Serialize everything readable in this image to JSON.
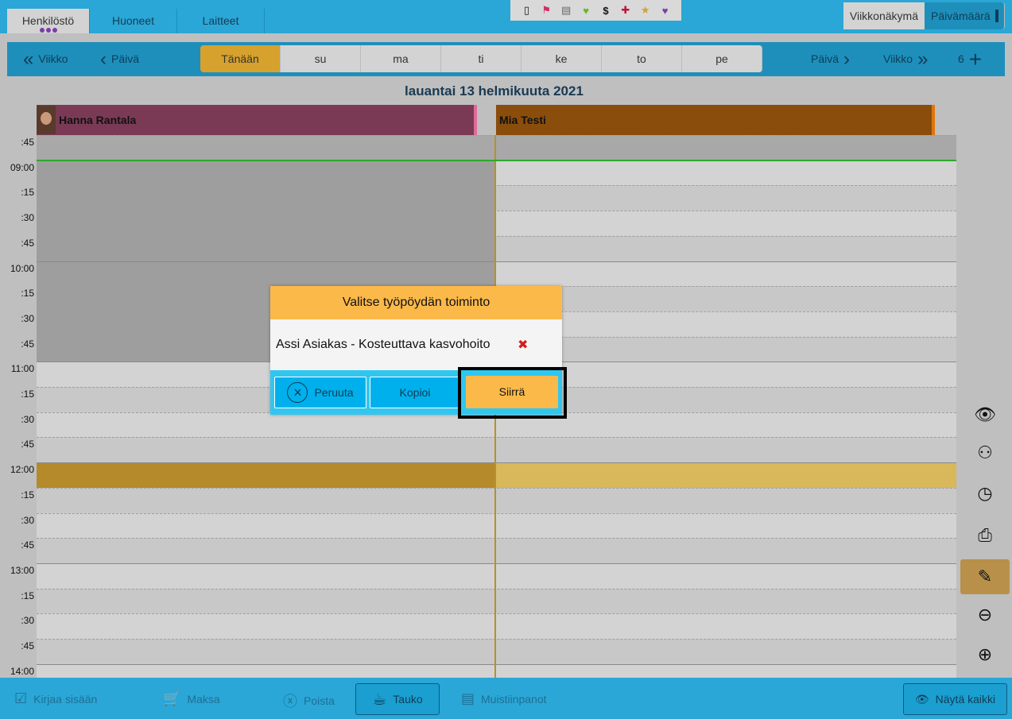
{
  "tabs": [
    {
      "label": "Henkilöstö",
      "active": true
    },
    {
      "label": "Huoneet",
      "active": false
    },
    {
      "label": "Laitteet",
      "active": false
    }
  ],
  "iconbar": {
    "icons": [
      "phone-icon",
      "flag-icon",
      "clipboard-icon",
      "heart-icon",
      "dollar-icon",
      "cross-icon",
      "star-icon",
      "broken-heart-icon"
    ],
    "glyphs": [
      "▯",
      "⚑",
      "▤",
      "♥",
      "$",
      "✚",
      "★",
      "♥"
    ],
    "colors": [
      "#111111",
      "#d42a6a",
      "#666666",
      "#6ab52a",
      "#111111",
      "#c2123a",
      "#d6a12c",
      "#7a3ea8"
    ]
  },
  "view_toggle": {
    "week": "Viikkonäkymä",
    "day": "Päivämäärä"
  },
  "nav": {
    "prev_week": "Viikko",
    "prev_day": "Päivä",
    "days": [
      "Tänään",
      "su",
      "ma",
      "ti",
      "ke",
      "to",
      "pe"
    ],
    "next_day": "Päivä",
    "next_week": "Viikko",
    "count": "6"
  },
  "date_title": "lauantai 13 helmikuuta 2021",
  "resources": [
    {
      "name": "Hanna Rantala",
      "color": "#7a3a55"
    },
    {
      "name": "Mia Testi",
      "color": "#8a4d0c"
    }
  ],
  "time_slots": [
    ":45",
    "09:00",
    ":15",
    ":30",
    ":45",
    "10:00",
    ":15",
    ":30",
    ":45",
    "11:00",
    ":15",
    ":30",
    ":45",
    "12:00",
    ":15",
    ":30",
    ":45",
    "13:00",
    ":15",
    ":30",
    ":45",
    "14:00"
  ],
  "dialog": {
    "title": "Valitse työpöydän toiminto",
    "item": "Assi Asiakas - Kosteuttava kasvohoito",
    "cancel": "Peruuta",
    "copy": "Kopioi",
    "move": "Siirrä"
  },
  "bottombar": {
    "checkin": "Kirjaa sisään",
    "pay": "Maksa",
    "delete": "Poista",
    "break": "Tauko",
    "notes": "Muistiinpanot",
    "show_all": "Näytä kaikki"
  }
}
